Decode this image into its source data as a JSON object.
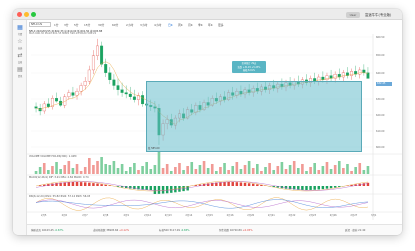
{
  "titlebar": {
    "user_label": "User",
    "app_label": "富途牛牛(专业版)",
    "colors": {
      "close": "#ff5f57",
      "minimize": "#febc2e",
      "maximize": "#28c840"
    }
  },
  "sidebar": {
    "items": [
      {
        "icon": "chart-icon",
        "label": "行情"
      },
      {
        "icon": "watchlist-icon",
        "label": "自选"
      },
      {
        "icon": "trade-icon",
        "label": "交易"
      },
      {
        "icon": "news-icon",
        "label": "资讯"
      }
    ]
  },
  "toolbar": {
    "symbol": "NFLX.US",
    "timeframes": [
      "1分",
      "3分",
      "5分",
      "15分",
      "30分",
      "60分",
      "2小时",
      "3小时",
      "4小时",
      "日K",
      "周K",
      "月K",
      "季K",
      "年K",
      "更多"
    ],
    "active_timeframe": "日K",
    "ohlc_line": "NFLX 2024/03/15 开:602.33 高:610.00 低:601.50 收:605.88",
    "ohlc_line2": "MA5 606.32 MA10 601.55 MA20 598.14 MA30 590.22"
  },
  "price_axis": {
    "labels": [
      "660.50",
      "650.00",
      "640.00",
      "630.00",
      "620.00",
      "610.00",
      "600.00"
    ],
    "current_price": "632.45"
  },
  "date_axis": {
    "labels": [
      "2月5",
      "2月6",
      "2月7",
      "2月8",
      "2月9",
      "2月12",
      "2月13",
      "2月14",
      "2月15",
      "2月16",
      "2月20",
      "2月21",
      "2月22",
      "2月23",
      "2月26",
      "2月27",
      "3月1"
    ]
  },
  "range_selection": {
    "tag_line1": "区间统计 29天",
    "tag_line2": "涨跌 +31.45 +5.23%",
    "tag_line3": "振幅 8.91%",
    "footer": "低 585.00"
  },
  "panels": {
    "volume_label": "VOLUME  VOLUME HOLDS(300): 1.42M",
    "macd_label": "MACD(12,26,9)  DIF: 3.21  DEA: 2.84  MACD: 0.74",
    "rsi_label": "RSI(6,12,24)  RSI1: 55.82  RSI2: 57.14  RSI3: 56.03"
  },
  "statusbar": {
    "items": [
      {
        "label": "纳斯达克",
        "value": "16103.45",
        "change": "-0.67%",
        "tone": "dn"
      },
      {
        "label": "道琼斯指数",
        "value": "38905.66",
        "change": "+0.12%",
        "tone": "up"
      },
      {
        "label": "标普500",
        "value": "5117.09",
        "change": "-0.65%",
        "tone": "dn"
      },
      {
        "label": "恒生指数",
        "value": "16720.89",
        "change": "+0.05%",
        "tone": "up"
      }
    ],
    "right": "延迟 · 盘前 21:40"
  },
  "chart_data": {
    "type": "candlestick",
    "note_series": "approximate daily candles read visually",
    "candles": [
      [
        612,
        615,
        608,
        611
      ],
      [
        611,
        614,
        606,
        609
      ],
      [
        609,
        616,
        607,
        614
      ],
      [
        614,
        618,
        611,
        612
      ],
      [
        612,
        620,
        610,
        618
      ],
      [
        618,
        622,
        615,
        616
      ],
      [
        616,
        619,
        612,
        613
      ],
      [
        613,
        621,
        611,
        619
      ],
      [
        619,
        624,
        617,
        622
      ],
      [
        622,
        626,
        618,
        620
      ],
      [
        620,
        625,
        617,
        623
      ],
      [
        623,
        629,
        620,
        627
      ],
      [
        627,
        633,
        624,
        630
      ],
      [
        630,
        641,
        628,
        638
      ],
      [
        638,
        652,
        635,
        648
      ],
      [
        648,
        660,
        645,
        655
      ],
      [
        655,
        658,
        640,
        642
      ],
      [
        642,
        646,
        633,
        636
      ],
      [
        636,
        640,
        628,
        631
      ],
      [
        631,
        635,
        624,
        627
      ],
      [
        627,
        632,
        620,
        624
      ],
      [
        624,
        629,
        619,
        622
      ],
      [
        622,
        627,
        618,
        621
      ],
      [
        621,
        626,
        617,
        619
      ],
      [
        619,
        624,
        615,
        617
      ],
      [
        617,
        622,
        613,
        620
      ],
      [
        620,
        623,
        612,
        614
      ],
      [
        614,
        618,
        610,
        613
      ],
      [
        613,
        617,
        609,
        612
      ],
      [
        612,
        616,
        608,
        611
      ],
      [
        611,
        614,
        585,
        592
      ],
      [
        592,
        603,
        588,
        600
      ],
      [
        600,
        606,
        596,
        603
      ],
      [
        603,
        607,
        597,
        599
      ],
      [
        599,
        606,
        596,
        604
      ],
      [
        604,
        610,
        601,
        607
      ],
      [
        607,
        611,
        602,
        604
      ],
      [
        604,
        612,
        603,
        610
      ],
      [
        610,
        614,
        606,
        608
      ],
      [
        608,
        615,
        606,
        613
      ],
      [
        613,
        616,
        608,
        610
      ],
      [
        610,
        617,
        609,
        615
      ],
      [
        615,
        619,
        611,
        613
      ],
      [
        613,
        620,
        612,
        618
      ],
      [
        618,
        622,
        614,
        616
      ],
      [
        616,
        621,
        613,
        619
      ],
      [
        619,
        623,
        615,
        617
      ],
      [
        617,
        624,
        616,
        622
      ],
      [
        622,
        626,
        617,
        620
      ],
      [
        620,
        625,
        618,
        623
      ],
      [
        623,
        627,
        619,
        621
      ],
      [
        621,
        626,
        618,
        624
      ],
      [
        624,
        628,
        620,
        622
      ],
      [
        622,
        627,
        619,
        625
      ],
      [
        625,
        629,
        621,
        623
      ],
      [
        623,
        628,
        620,
        626
      ],
      [
        626,
        630,
        622,
        624
      ],
      [
        624,
        629,
        621,
        627
      ],
      [
        627,
        631,
        623,
        625
      ],
      [
        625,
        630,
        622,
        628
      ],
      [
        628,
        632,
        624,
        626
      ],
      [
        626,
        631,
        623,
        629
      ],
      [
        629,
        633,
        625,
        627
      ],
      [
        627,
        632,
        624,
        630
      ],
      [
        630,
        634,
        626,
        628
      ],
      [
        628,
        633,
        625,
        631
      ],
      [
        631,
        635,
        627,
        629
      ],
      [
        629,
        634,
        626,
        632
      ],
      [
        632,
        636,
        628,
        630
      ],
      [
        630,
        635,
        627,
        633
      ],
      [
        633,
        637,
        629,
        631
      ],
      [
        631,
        636,
        628,
        634
      ],
      [
        634,
        638,
        630,
        632
      ],
      [
        632,
        637,
        629,
        635
      ],
      [
        635,
        639,
        631,
        633
      ],
      [
        633,
        638,
        630,
        636
      ],
      [
        636,
        640,
        632,
        634
      ],
      [
        634,
        639,
        631,
        637
      ],
      [
        637,
        641,
        633,
        635
      ],
      [
        635,
        640,
        632,
        638
      ],
      [
        638,
        642,
        634,
        636
      ],
      [
        636,
        640,
        633,
        632
      ]
    ]
  }
}
